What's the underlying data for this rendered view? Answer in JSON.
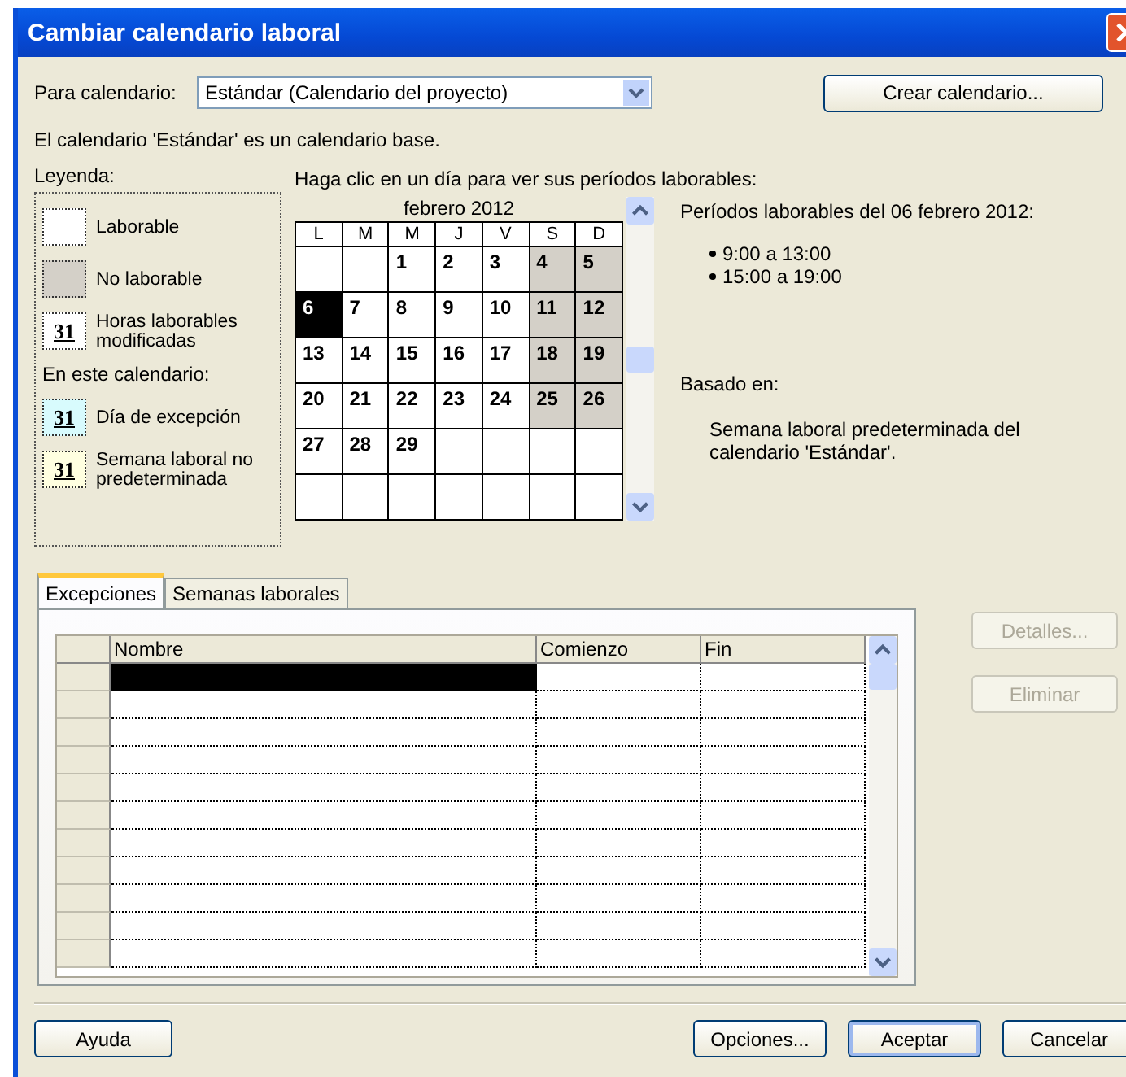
{
  "window": {
    "title": "Cambiar calendario laboral"
  },
  "calendar_picker": {
    "label": "Para calendario:",
    "value": "Estándar (Calendario del proyecto)"
  },
  "create_button": "Crear calendario...",
  "info": "El calendario 'Estándar' es un calendario base.",
  "legend": {
    "title": "Leyenda:",
    "items": [
      {
        "kind": "working",
        "label": "Laborable"
      },
      {
        "kind": "nonworking",
        "label": "No laborable"
      },
      {
        "kind": "modified",
        "sample": "31",
        "label": "Horas laborables modificadas"
      }
    ],
    "subheading": "En este calendario:",
    "calendar_items": [
      {
        "kind": "exception",
        "sample": "31",
        "label": "Día de excepción"
      },
      {
        "kind": "nondefault",
        "sample": "31",
        "label": "Semana laboral no predeterminada"
      }
    ]
  },
  "calendar": {
    "instruction": "Haga clic en un día para ver sus períodos laborables:",
    "month": "febrero 2012",
    "weekdays": [
      "L",
      "M",
      "M",
      "J",
      "V",
      "S",
      "D"
    ],
    "weeks": [
      [
        {
          "nonworking": false,
          "selected": false
        },
        {
          "nonworking": false,
          "selected": false
        },
        {
          "day": "1",
          "nonworking": false,
          "selected": false
        },
        {
          "day": "2",
          "nonworking": false,
          "selected": false
        },
        {
          "day": "3",
          "nonworking": false,
          "selected": false
        },
        {
          "day": "4",
          "nonworking": true,
          "selected": false
        },
        {
          "day": "5",
          "nonworking": true,
          "selected": false
        }
      ],
      [
        {
          "day": "6",
          "nonworking": false,
          "selected": true
        },
        {
          "day": "7",
          "nonworking": false,
          "selected": false
        },
        {
          "day": "8",
          "nonworking": false,
          "selected": false
        },
        {
          "day": "9",
          "nonworking": false,
          "selected": false
        },
        {
          "day": "10",
          "nonworking": false,
          "selected": false
        },
        {
          "day": "11",
          "nonworking": true,
          "selected": false
        },
        {
          "day": "12",
          "nonworking": true,
          "selected": false
        }
      ],
      [
        {
          "day": "13",
          "nonworking": false,
          "selected": false
        },
        {
          "day": "14",
          "nonworking": false,
          "selected": false
        },
        {
          "day": "15",
          "nonworking": false,
          "selected": false
        },
        {
          "day": "16",
          "nonworking": false,
          "selected": false
        },
        {
          "day": "17",
          "nonworking": false,
          "selected": false
        },
        {
          "day": "18",
          "nonworking": true,
          "selected": false
        },
        {
          "day": "19",
          "nonworking": true,
          "selected": false
        }
      ],
      [
        {
          "day": "20",
          "nonworking": false,
          "selected": false
        },
        {
          "day": "21",
          "nonworking": false,
          "selected": false
        },
        {
          "day": "22",
          "nonworking": false,
          "selected": false
        },
        {
          "day": "23",
          "nonworking": false,
          "selected": false
        },
        {
          "day": "24",
          "nonworking": false,
          "selected": false
        },
        {
          "day": "25",
          "nonworking": true,
          "selected": false
        },
        {
          "day": "26",
          "nonworking": true,
          "selected": false
        }
      ],
      [
        {
          "day": "27",
          "nonworking": false,
          "selected": false
        },
        {
          "day": "28",
          "nonworking": false,
          "selected": false
        },
        {
          "day": "29",
          "nonworking": false,
          "selected": false
        },
        {
          "nonworking": false,
          "selected": false
        },
        {
          "nonworking": false,
          "selected": false
        },
        {
          "nonworking": false,
          "selected": false
        },
        {
          "nonworking": false,
          "selected": false
        }
      ],
      [
        {
          "nonworking": false,
          "selected": false
        },
        {
          "nonworking": false,
          "selected": false
        },
        {
          "nonworking": false,
          "selected": false
        },
        {
          "nonworking": false,
          "selected": false
        },
        {
          "nonworking": false,
          "selected": false
        },
        {
          "nonworking": false,
          "selected": false
        },
        {
          "nonworking": false,
          "selected": false
        }
      ]
    ]
  },
  "periods": {
    "title": "Períodos laborables del 06 febrero 2012:",
    "items": [
      "9:00 a 13:00",
      "15:00 a 19:00"
    ],
    "based_on_title": "Basado en:",
    "based_on": "Semana laboral predeterminada del calendario 'Estándar'."
  },
  "tabs": [
    {
      "label": "Excepciones",
      "selected": true
    },
    {
      "label": "Semanas laborales",
      "selected": false
    }
  ],
  "table": {
    "columns": [
      "Nombre",
      "Comienzo",
      "Fin"
    ],
    "rows": [
      {
        "selected": true
      },
      {
        "selected": false
      },
      {
        "selected": false
      },
      {
        "selected": false
      },
      {
        "selected": false
      },
      {
        "selected": false
      },
      {
        "selected": false
      },
      {
        "selected": false
      },
      {
        "selected": false
      },
      {
        "selected": false
      },
      {
        "selected": false
      }
    ]
  },
  "side_buttons": [
    {
      "label": "Detalles...",
      "disabled": true
    },
    {
      "label": "Eliminar",
      "disabled": true
    }
  ],
  "buttons": [
    {
      "label": "Ayuda",
      "default": false
    },
    {
      "label": "Opciones...",
      "default": false
    },
    {
      "label": "Aceptar",
      "default": true
    },
    {
      "label": "Cancelar",
      "default": false
    }
  ]
}
